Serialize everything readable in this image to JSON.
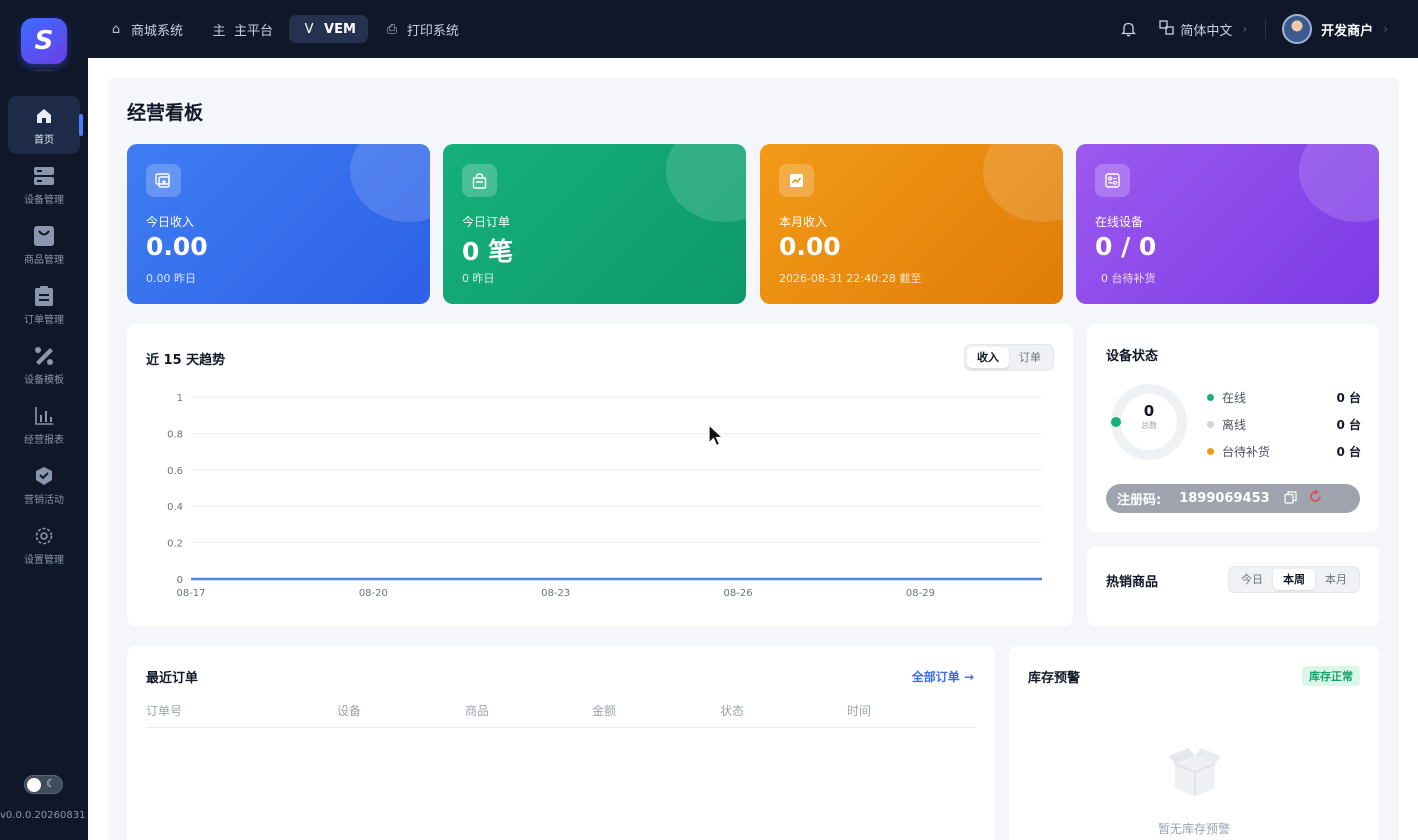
{
  "app": {
    "logo_letter": "S",
    "version": "v0.0.0.20260831"
  },
  "topnav": {
    "tabs": [
      {
        "icon": "store-icon",
        "glyph": "⌂",
        "label": "商城系统",
        "active": false
      },
      {
        "icon": "main-icon",
        "glyph": "主",
        "label": "主平台",
        "active": false
      },
      {
        "icon": "vem-icon",
        "glyph": "V",
        "label": "VEM",
        "active": true
      },
      {
        "icon": "printer-icon",
        "glyph": "⎙",
        "label": "打印系统",
        "active": false
      }
    ],
    "language": "简体中文",
    "user_name": "开发商户"
  },
  "sidebar": {
    "items": [
      {
        "icon": "home-icon",
        "label": "首页",
        "active": true
      },
      {
        "icon": "device-icon",
        "label": "设备管理"
      },
      {
        "icon": "bag-icon",
        "label": "商品管理"
      },
      {
        "icon": "clipboard-icon",
        "label": "订单管理"
      },
      {
        "icon": "template-icon",
        "label": "设备模板"
      },
      {
        "icon": "report-icon",
        "label": "经营报表"
      },
      {
        "icon": "promo-icon",
        "label": "营销活动"
      },
      {
        "icon": "settings-icon",
        "label": "设置管理"
      }
    ]
  },
  "page": {
    "title": "经营看板"
  },
  "stats": [
    {
      "icon": "wallet-icon",
      "label": "今日收入",
      "value": "0.00",
      "sub": "0.00 昨日",
      "color": "#3f7df3"
    },
    {
      "icon": "shopping-bag-icon",
      "label": "今日订单",
      "value": "0 笔",
      "sub": "0 昨日",
      "color": "#16b07a"
    },
    {
      "icon": "chart-icon",
      "label": "本月收入",
      "value": "0.00",
      "sub": "2026-08-31 22:40:28 截至",
      "color": "#f29a17"
    },
    {
      "icon": "device-status-icon",
      "label": "在线设备",
      "value": "0 / 0",
      "sub": "0 台待补货",
      "color": "#9b59ef"
    }
  ],
  "trend": {
    "title": "近 15 天趋势",
    "toggle": [
      "收入",
      "订单"
    ],
    "active_toggle": "收入"
  },
  "chart_data": {
    "type": "line",
    "x": [
      "08-17",
      "08-18",
      "08-19",
      "08-20",
      "08-21",
      "08-22",
      "08-23",
      "08-24",
      "08-25",
      "08-26",
      "08-27",
      "08-28",
      "08-29",
      "08-30",
      "08-31"
    ],
    "x_tick_labels": [
      "08-17",
      "08-20",
      "08-23",
      "08-26",
      "08-29"
    ],
    "series": [
      {
        "values": [
          0,
          0,
          0,
          0,
          0,
          0,
          0,
          0,
          0,
          0,
          0,
          0,
          0,
          0,
          0
        ],
        "color": "#4a86e8"
      }
    ],
    "y_ticks": [
      0,
      0.2,
      0.4,
      0.6,
      0.8,
      1
    ],
    "ylim": [
      0,
      1
    ],
    "grid": true,
    "title": "",
    "xlabel": "",
    "ylabel": ""
  },
  "device_status": {
    "title": "设备状态",
    "total": "0",
    "total_label": "总数",
    "rows": [
      {
        "label": "在线",
        "value": "0 台",
        "color": "#16b07a"
      },
      {
        "label": "离线",
        "value": "0 台",
        "color": "#d1d5db"
      },
      {
        "label": "台待补货",
        "value": "0 台",
        "color": "#f29a17"
      }
    ],
    "reg_label": "注册码:",
    "reg_code": "1899069453"
  },
  "hot_products": {
    "title": "热销商品",
    "toggle": [
      "今日",
      "本周",
      "本月"
    ],
    "active_toggle": "本周"
  },
  "recent_orders": {
    "title": "最近订单",
    "link": "全部订单 →",
    "columns": [
      "订单号",
      "设备",
      "商品",
      "金额",
      "状态",
      "时间"
    ]
  },
  "stock": {
    "title": "库存预警",
    "badge": "库存正常",
    "empty_text": "暂无库存预警"
  }
}
